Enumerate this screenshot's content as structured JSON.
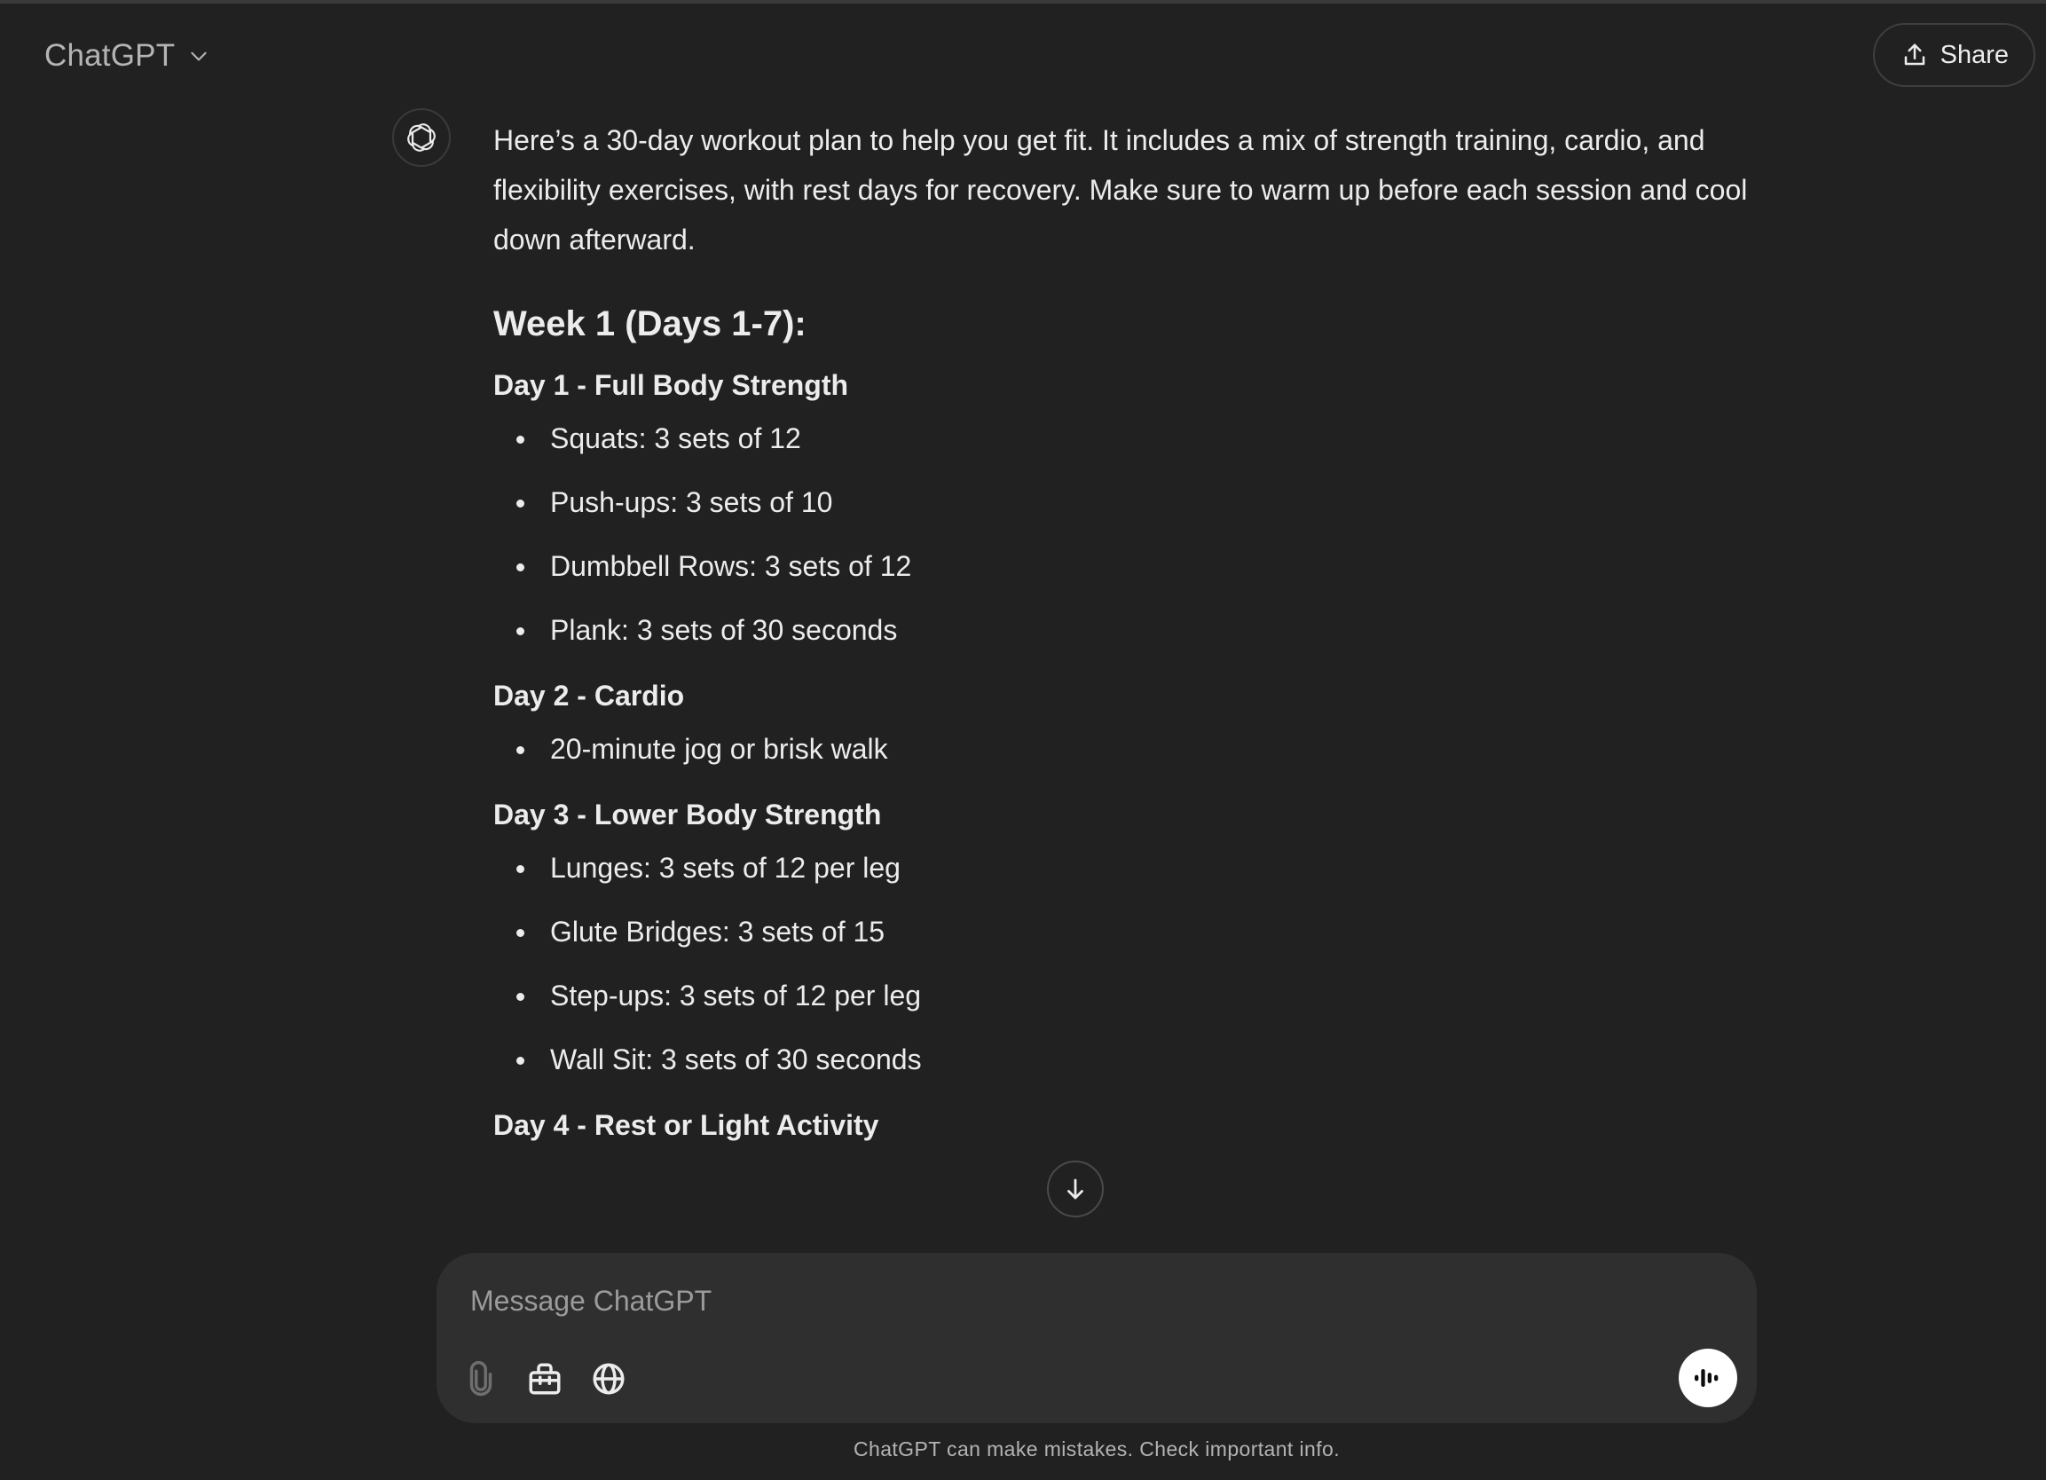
{
  "header": {
    "model_name": "ChatGPT",
    "share_label": "Share"
  },
  "assistant_message": {
    "intro": "Here’s a 30-day workout plan to help you get fit. It includes a mix of strength training, cardio, and flexibility exercises, with rest days for recovery. Make sure to warm up before each session and cool down afterward.",
    "week_heading": "Week 1 (Days 1-7):",
    "days": [
      {
        "title": "Day 1 - Full Body Strength",
        "items": [
          "Squats: 3 sets of 12",
          "Push-ups: 3 sets of 10",
          "Dumbbell Rows: 3 sets of 12",
          "Plank: 3 sets of 30 seconds"
        ]
      },
      {
        "title": "Day 2 - Cardio",
        "items": [
          "20-minute jog or brisk walk"
        ]
      },
      {
        "title": "Day 3 - Lower Body Strength",
        "items": [
          "Lunges: 3 sets of 12 per leg",
          "Glute Bridges: 3 sets of 15",
          "Step-ups: 3 sets of 12 per leg",
          "Wall Sit: 3 sets of 30 seconds"
        ]
      },
      {
        "title": "Day 4 - Rest or Light Activity",
        "items": []
      }
    ]
  },
  "composer": {
    "placeholder": "Message ChatGPT"
  },
  "icons": {
    "model_dropdown": "chevron-down-icon",
    "share": "share-upload-icon",
    "avatar": "openai-logo-icon",
    "scroll_down": "arrow-down-icon",
    "attach": "paperclip-icon",
    "tools": "toolbox-icon",
    "search": "globe-icon",
    "voice": "voice-waveform-icon"
  },
  "footer": {
    "disclaimer": "ChatGPT can make mistakes. Check important info."
  },
  "colors": {
    "background": "#212121",
    "composer_bg": "#2f2f2f",
    "text": "#ececec",
    "muted_text": "#b4b4b4",
    "voice_button_bg": "#ffffff"
  }
}
